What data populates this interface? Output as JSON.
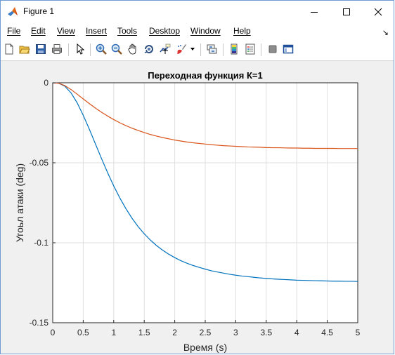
{
  "window": {
    "title": "Figure 1",
    "controls": [
      "minimize",
      "maximize",
      "close"
    ]
  },
  "menu": {
    "items": [
      "File",
      "Edit",
      "View",
      "Insert",
      "Tools",
      "Desktop",
      "Window",
      "Help"
    ],
    "dock_glyph": "↘"
  },
  "toolbar": {
    "icons": [
      "new-figure-icon",
      "open-file-icon",
      "save-icon",
      "print-icon",
      "pointer-icon",
      "zoom-in-icon",
      "zoom-out-icon",
      "pan-icon",
      "rotate-3d-icon",
      "data-cursor-icon",
      "brush-icon",
      "brush-dropdown-icon",
      "link-plot-icon",
      "colorbar-icon",
      "legend-icon",
      "hide-plot-tools-icon",
      "show-plot-tools-icon"
    ]
  },
  "chart_data": {
    "type": "line",
    "title": "Переходная функция К=1",
    "xlabel": "Время (s)",
    "ylabel": "Угоьл атаки (deg)",
    "xlim": [
      0,
      5
    ],
    "ylim": [
      -0.15,
      0
    ],
    "xticks": [
      0,
      0.5,
      1,
      1.5,
      2,
      2.5,
      3,
      3.5,
      4,
      4.5,
      5
    ],
    "xtick_labels": [
      "0",
      "0.5",
      "1",
      "1.5",
      "2",
      "2.5",
      "3",
      "3.5",
      "4",
      "4.5",
      "5"
    ],
    "yticks": [
      0,
      -0.05,
      -0.1,
      -0.15
    ],
    "ytick_labels": [
      "0",
      "-0.05",
      "-0.1",
      "-0.15"
    ],
    "grid": true,
    "colors": {
      "series_blue": "#0072bd",
      "series_orange": "#d95319",
      "grid": "#dfdfdf"
    },
    "x": [
      0,
      0.1,
      0.2,
      0.3,
      0.4,
      0.5,
      0.6,
      0.7,
      0.8,
      0.9,
      1.0,
      1.1,
      1.2,
      1.3,
      1.4,
      1.5,
      1.6,
      1.7,
      1.8,
      1.9,
      2.0,
      2.1,
      2.2,
      2.3,
      2.4,
      2.5,
      2.6,
      2.7,
      2.8,
      2.9,
      3.0,
      3.1,
      3.2,
      3.3,
      3.4,
      3.5,
      3.6,
      3.7,
      3.8,
      3.9,
      4.0,
      4.1,
      4.2,
      4.3,
      4.4,
      4.5,
      4.6,
      4.7,
      4.8,
      4.9,
      5.0
    ],
    "series": [
      {
        "color": "#0072bd",
        "values": [
          0,
          -0.0003,
          -0.0022,
          -0.0063,
          -0.0125,
          -0.0203,
          -0.029,
          -0.0382,
          -0.0474,
          -0.0562,
          -0.0645,
          -0.072,
          -0.0787,
          -0.0847,
          -0.0899,
          -0.0944,
          -0.0983,
          -0.1017,
          -0.1046,
          -0.1071,
          -0.1093,
          -0.1112,
          -0.1128,
          -0.1142,
          -0.1154,
          -0.1165,
          -0.1175,
          -0.1183,
          -0.119,
          -0.1197,
          -0.1203,
          -0.1208,
          -0.1212,
          -0.1216,
          -0.122,
          -0.1223,
          -0.1226,
          -0.1228,
          -0.123,
          -0.1232,
          -0.1234,
          -0.1235,
          -0.1236,
          -0.1237,
          -0.1238,
          -0.1239,
          -0.124,
          -0.124,
          -0.1241,
          -0.1241,
          -0.1242
        ]
      },
      {
        "color": "#d95319",
        "values": [
          0,
          -0.0003,
          -0.0018,
          -0.0042,
          -0.0071,
          -0.0101,
          -0.013,
          -0.0158,
          -0.0184,
          -0.0208,
          -0.023,
          -0.025,
          -0.0268,
          -0.0284,
          -0.0298,
          -0.0311,
          -0.0323,
          -0.0333,
          -0.0342,
          -0.035,
          -0.0358,
          -0.0364,
          -0.037,
          -0.0375,
          -0.0379,
          -0.0383,
          -0.0387,
          -0.039,
          -0.0393,
          -0.0395,
          -0.0397,
          -0.0399,
          -0.0401,
          -0.0402,
          -0.0403,
          -0.0405,
          -0.0406,
          -0.0406,
          -0.0407,
          -0.0408,
          -0.0408,
          -0.0409,
          -0.0409,
          -0.041,
          -0.041,
          -0.041,
          -0.041,
          -0.0411,
          -0.0411,
          -0.0411,
          -0.0411
        ]
      }
    ]
  }
}
